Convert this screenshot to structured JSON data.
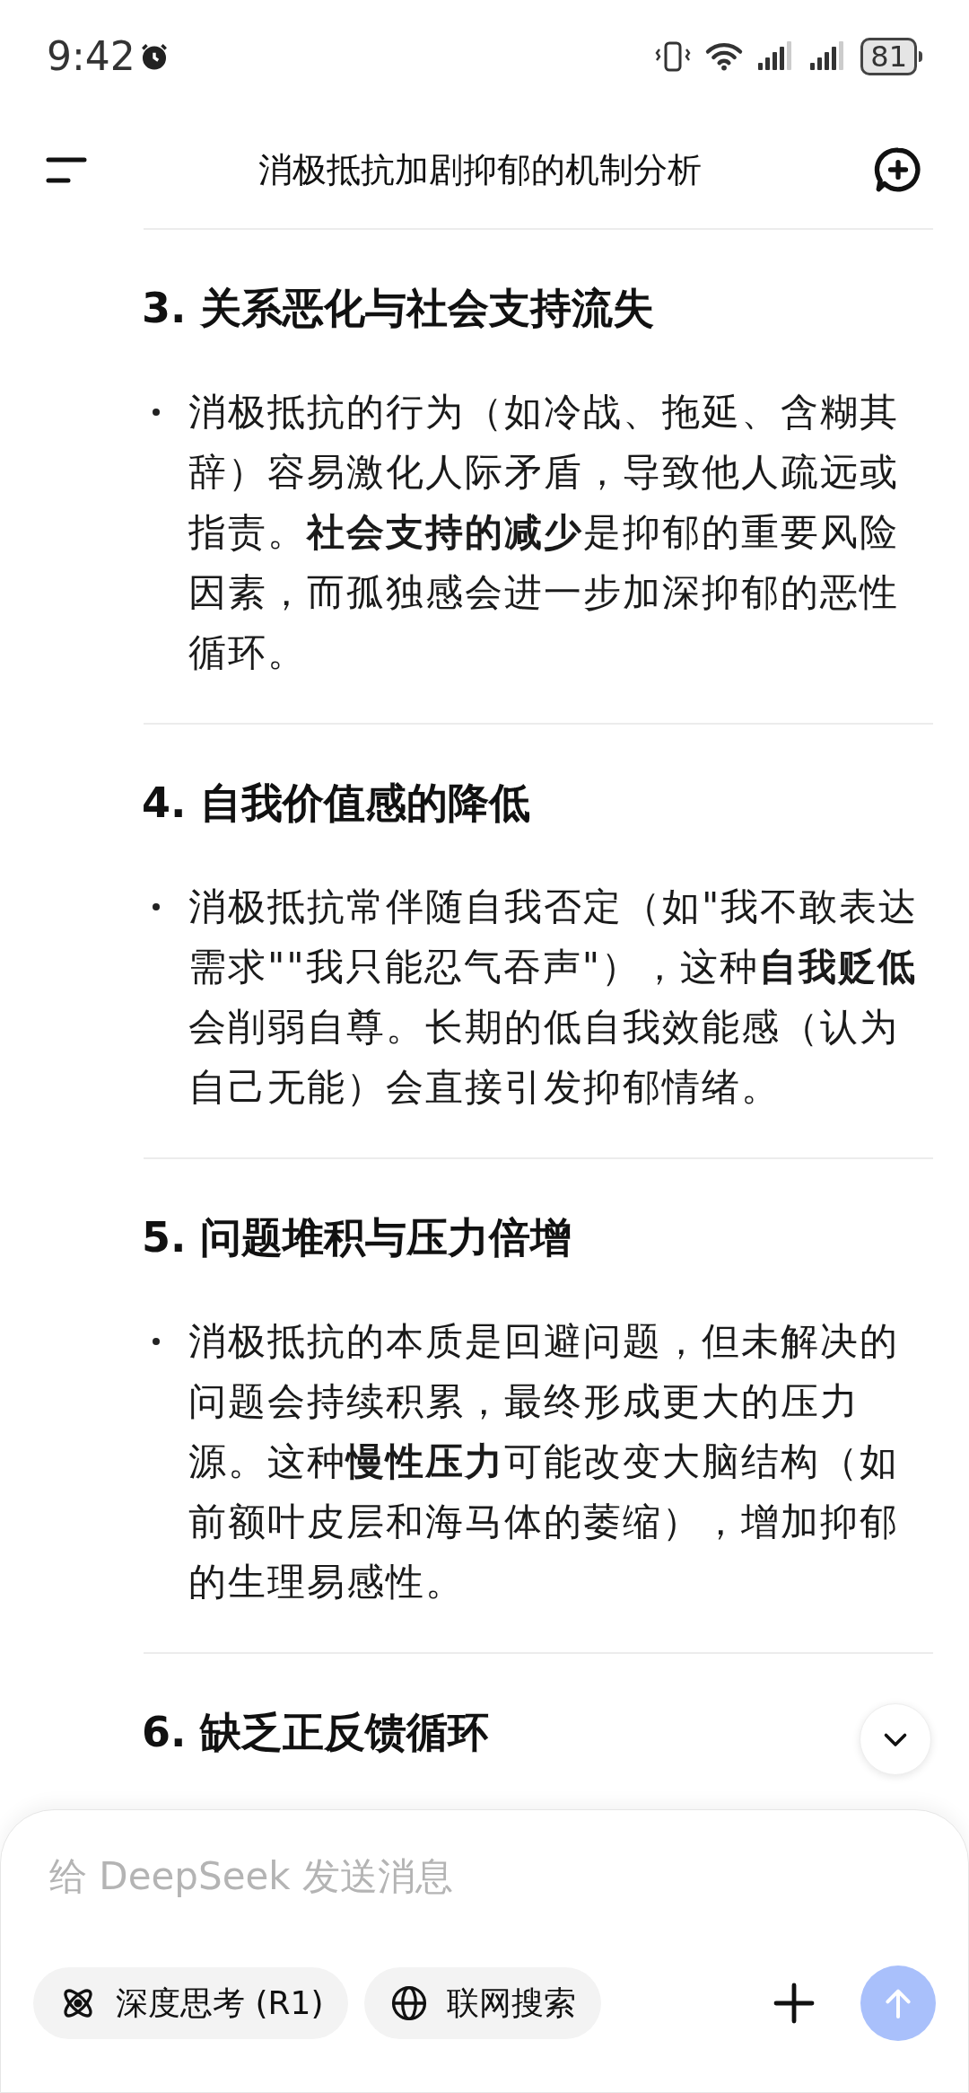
{
  "status_bar": {
    "time": "9:42",
    "battery": "81"
  },
  "header": {
    "title": "消极抵抗加剧抑郁的机制分析"
  },
  "sections": [
    {
      "heading": "3. 关系恶化与社会支持流失",
      "bullets": [
        "消极抵抗的行为（如冷战、拖延、含糊其辞）容易激化人际矛盾，导致他人疏远或指责。**社会支持的减少**是抑郁的重要风险因素，而孤独感会进一步加深抑郁的恶性循环。"
      ]
    },
    {
      "heading": "4. 自我价值感的降低",
      "bullets": [
        "消极抵抗常伴随自我否定（如\"我不敢表达需求\"\"我只能忍气吞声\"），这种**自我贬低**会削弱自尊。长期的低自我效能感（认为自己无能）会直接引发抑郁情绪。"
      ]
    },
    {
      "heading": "5. 问题堆积与压力倍增",
      "bullets": [
        "消极抵抗的本质是回避问题，但未解决的问题会持续积累，最终形成更大的压力源。这种**慢性压力**可能改变大脑结构（如前额叶皮层和海马体的萎缩），增加抑郁的生理易感性。"
      ]
    },
    {
      "heading": "6. 缺乏正反馈循环"
    }
  ],
  "composer": {
    "placeholder": "给 DeepSeek 发送消息",
    "chips": [
      {
        "kind": "think",
        "label": "深度思考 (R1)",
        "selected": false
      },
      {
        "kind": "web",
        "label": "联网搜索",
        "selected": false
      }
    ],
    "send_disabled": true
  }
}
